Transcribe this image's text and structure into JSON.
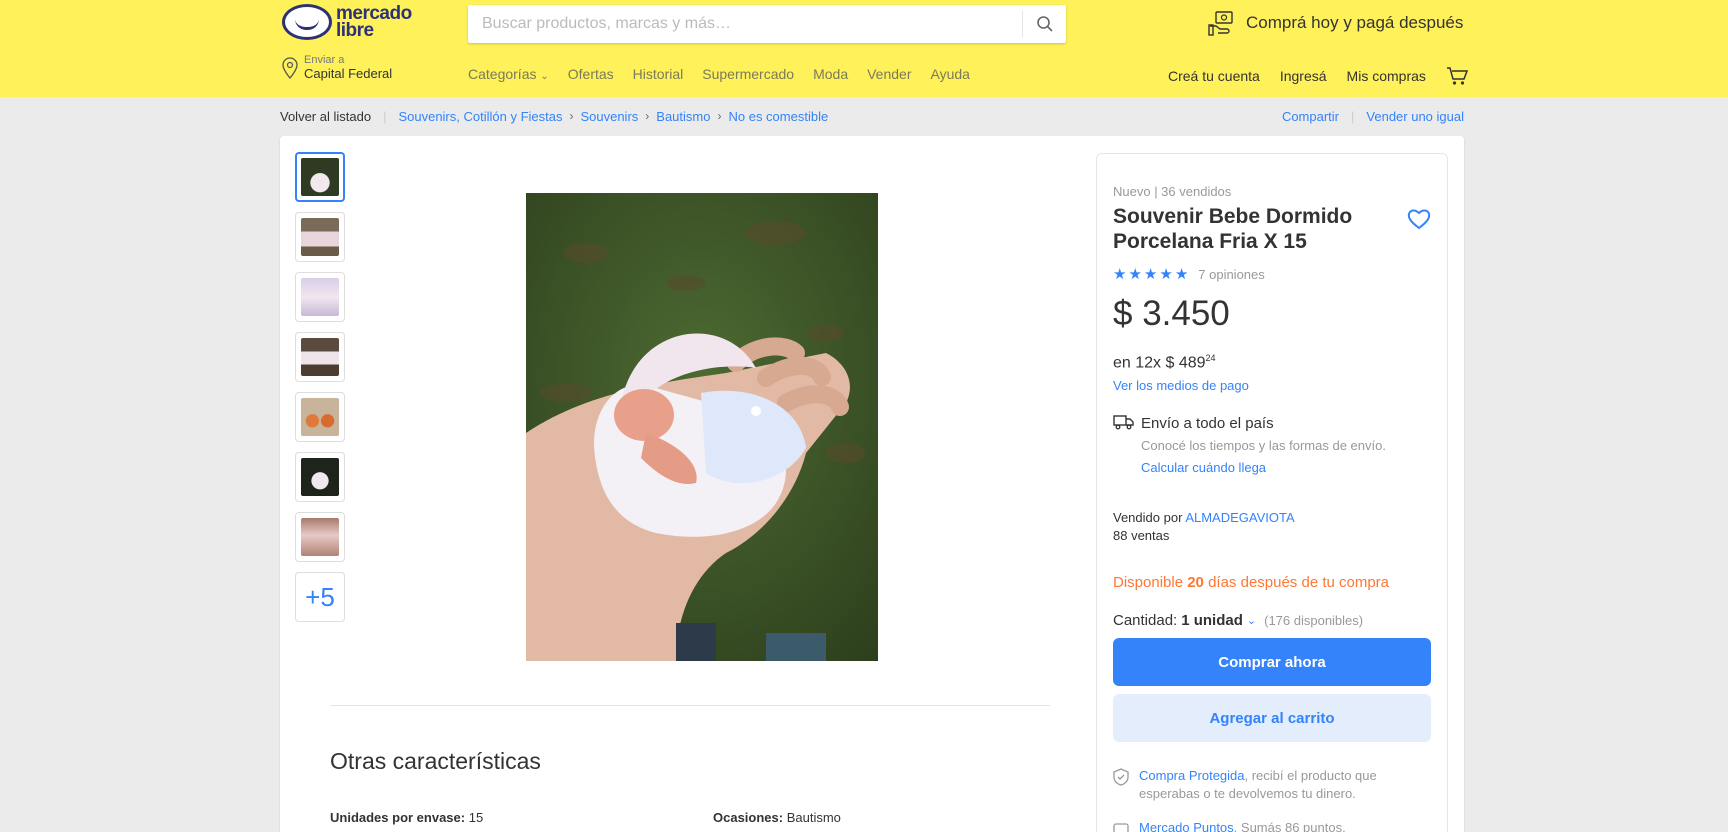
{
  "header": {
    "logo_text_line1": "mercado",
    "logo_text_line2": "libre",
    "search_placeholder": "Buscar productos, marcas y más…",
    "promo": "Comprá hoy y pagá después",
    "location_small": "Enviar a",
    "location_big": "Capital Federal",
    "nav": [
      "Categorías",
      "Ofertas",
      "Historial",
      "Supermercado",
      "Moda",
      "Vender",
      "Ayuda"
    ],
    "user_nav": [
      "Creá tu cuenta",
      "Ingresá",
      "Mis compras"
    ]
  },
  "breadcrumb": {
    "back": "Volver al listado",
    "items": [
      "Souvenirs, Cotillón y Fiestas",
      "Souvenirs",
      "Bautismo",
      "No es comestible"
    ],
    "share": "Compartir",
    "sell_same": "Vender uno igual"
  },
  "gallery": {
    "more": "+5"
  },
  "product": {
    "condition": "Nuevo  |  36 vendidos",
    "title": "Souvenir Bebe Dormido Porcelana Fria X 15",
    "rating": 5,
    "reviews": "7 opiniones",
    "price": "$ 3.450",
    "installments": "en 12x $ 489",
    "installments_cents": "24",
    "payment_link": "Ver los medios de pago",
    "shipping_title": "Envío a todo el país",
    "shipping_sub": "Conocé los tiempos y las formas de envío.",
    "shipping_link": "Calcular cuándo llega",
    "seller_prefix": "Vendido por",
    "seller_name": "ALMADEGAVIOTA",
    "seller_sales": "88 ventas",
    "availability_prefix": "Disponible",
    "availability_days": "20",
    "availability_suffix": "días después de tu compra",
    "qty_label": "Cantidad:",
    "qty_value": "1 unidad",
    "qty_available": "(176 disponibles)",
    "buy_now": "Comprar ahora",
    "add_cart": "Agregar al carrito",
    "protect_link": "Compra Protegida",
    "protect_text": ", recibí el producto que esperabas o te devolvemos tu dinero.",
    "points_link": "Mercado Puntos",
    "points_text": ". Sumás 86 puntos."
  },
  "details": {
    "section_title": "Otras características",
    "attrs": [
      {
        "key": "Unidades por envase:",
        "value": " 15"
      },
      {
        "key": "Ocasiones:",
        "value": " Bautismo"
      }
    ]
  },
  "colors": {
    "header": "#fff159",
    "accent": "#3483fa",
    "availability": "#ff7733"
  }
}
